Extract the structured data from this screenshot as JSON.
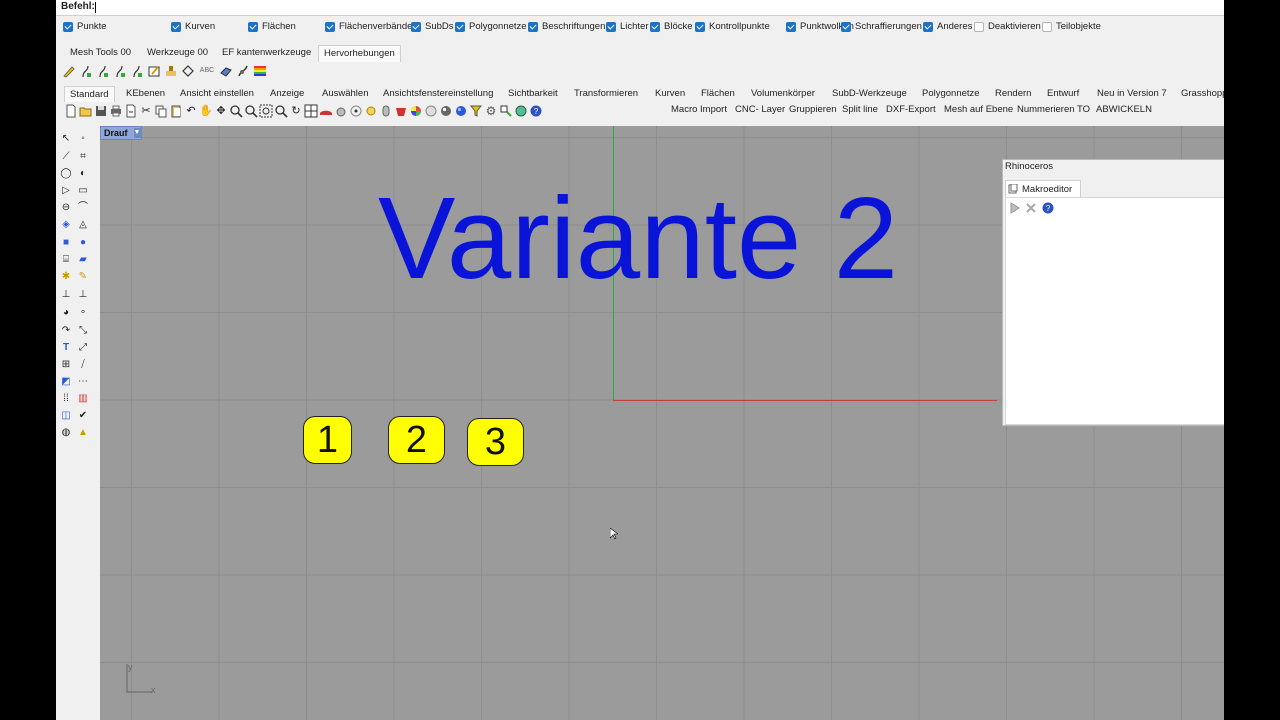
{
  "command": {
    "label": "Befehl:",
    "value": ""
  },
  "filters": [
    {
      "label": "Punkte",
      "checked": true
    },
    {
      "label": "Kurven",
      "checked": true
    },
    {
      "label": "Flächen",
      "checked": true
    },
    {
      "label": "Flächenverbände",
      "checked": true
    },
    {
      "label": "SubDs",
      "checked": true
    },
    {
      "label": "Polygonnetze",
      "checked": true
    },
    {
      "label": "Beschriftungen",
      "checked": true
    },
    {
      "label": "Lichter",
      "checked": true
    },
    {
      "label": "Blöcke",
      "checked": true
    },
    {
      "label": "Kontrollpunkte",
      "checked": true
    },
    {
      "label": "Punktwolken",
      "checked": true
    },
    {
      "label": "Schraffierungen",
      "checked": true
    },
    {
      "label": "Anderes",
      "checked": true
    },
    {
      "label": "Deaktivieren",
      "checked": false
    },
    {
      "label": "Teilobjekte",
      "checked": false
    }
  ],
  "top_tabs": [
    "Mesh Tools 00",
    "Werkzeuge 00",
    "EF kantenwerkzeuge",
    "Hervorhebungen"
  ],
  "main_tabs": [
    "Standard",
    "KEbenen",
    "Ansicht einstellen",
    "Anzeige",
    "Auswählen",
    "Ansichtsfenstereinstellung",
    "Sichtbarkeit",
    "Transformieren",
    "Kurven",
    "Flächen",
    "Volumenkörper",
    "SubD-Werkzeuge",
    "Polygonnetze",
    "Rendern",
    "Entwurf",
    "Neu in Version 7",
    "Grasshopp"
  ],
  "macros": [
    "Macro Import",
    "CNC- Layer",
    "Gruppieren",
    "Split line",
    "DXF-Export",
    "Mesh auf Ebene",
    "Nummerieren TO",
    "ABWICKELN"
  ],
  "viewport": {
    "name": "Drauf",
    "title_text": "Variante 2",
    "badges": [
      "1",
      "2",
      "3"
    ],
    "axis_x_label": "x",
    "axis_y_label": "y"
  },
  "panel": {
    "title": "Rhinoceros",
    "tab_label": "Makroeditor"
  },
  "colors": {
    "title_text": "#0a14d8",
    "badge_fill": "#ffff00",
    "viewport_bg": "#9b9b9b",
    "grid_line": "#8d8d8d",
    "axis_x": "#c0403a",
    "axis_y": "#27b03a",
    "checkbox": "#1a73c8",
    "viewport_tab": "#8fa6d8"
  },
  "icons": {
    "row1": [
      "pencil-icon",
      "curve-icon",
      "curve-icon",
      "curve-icon",
      "curve-icon",
      "edit-icon",
      "stamp-icon",
      "diamond-icon",
      "text-abc-icon",
      "box-icon",
      "brush-icon",
      "rainbow-icon"
    ],
    "row2": [
      "new-file-icon",
      "open-folder-icon",
      "save-icon",
      "print-icon",
      "import-icon",
      "cut-icon",
      "copy-icon",
      "paste-icon",
      "undo-icon",
      "hand-pan-icon",
      "move-icon",
      "zoom-in-icon",
      "zoom-window-icon",
      "zoom-extents-icon",
      "zoom-selected-icon",
      "rotate-view-icon",
      "grid-4view-icon",
      "car-icon",
      "zoom-icon",
      "curve-snap-icon",
      "light-icon",
      "lock-icon",
      "paint-icon",
      "color-wheel-icon",
      "sphere-grey-icon",
      "sphere-shaded-icon",
      "sphere-blue-icon",
      "filter-icon",
      "gear-settings-icon",
      "snap-icon",
      "globe-icon",
      "help-icon"
    ],
    "left": [
      "select-icon",
      "point-icon",
      "polyline-icon",
      "curve-point-icon",
      "circle-icon",
      "arc-icon",
      "polygon-icon",
      "rectangle-icon",
      "ellipse-icon",
      "fillet-icon",
      "surface-icon",
      "surface-edit-icon",
      "box-solid-icon",
      "sphere-solid-icon",
      "cylinder-icon",
      "mesh-icon",
      "transform-icon",
      "trim-icon",
      "split-icon",
      "join-icon",
      "boolean-icon",
      "offset-icon",
      "extend-icon",
      "analyze-icon",
      "text-icon",
      "dimension-icon",
      "array-icon",
      "mirror-icon",
      "block-icon",
      "group-icon",
      "grid-array-icon",
      "layer-icon",
      "surface-box-icon",
      "check-icon",
      "render-icon",
      "light-bulb-icon"
    ]
  }
}
